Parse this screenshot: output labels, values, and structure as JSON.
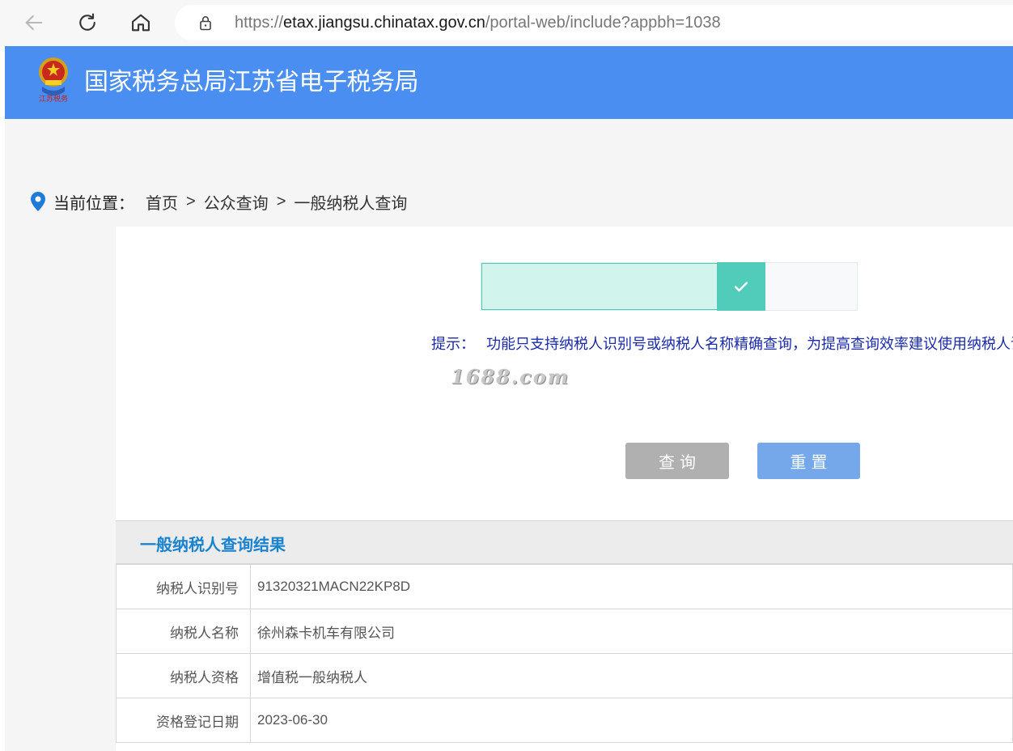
{
  "browser": {
    "url_scheme": "https://",
    "url_host": "etax.jiangsu.chinatax.gov.cn",
    "url_path": "/portal-web/include?appbh=1038"
  },
  "header": {
    "title": "国家税务总局江苏省电子税务局",
    "emblem_caption": "江苏税务"
  },
  "breadcrumb": {
    "label": "当前位置：",
    "items": [
      "首页",
      "公众查询",
      "一般纳税人查询"
    ],
    "separator": ">"
  },
  "slider": {
    "progress_percent": 72
  },
  "hint": {
    "label": "提示：",
    "text": "功能只支持纳税人识别号或纳税人名称精确查询，为提高查询效率建议使用纳税人识别号查询"
  },
  "watermark": "1688.com",
  "buttons": {
    "query": "查询",
    "reset": "重置"
  },
  "result": {
    "title": "一般纳税人查询结果",
    "rows": [
      {
        "field": "纳税人识别号",
        "value": "91320321MACN22KP8D"
      },
      {
        "field": "纳税人名称",
        "value": "徐州森卡机车有限公司"
      },
      {
        "field": "纳税人资格",
        "value": "增值税一般纳税人"
      },
      {
        "field": "资格登记日期",
        "value": "2023-06-30"
      }
    ]
  },
  "colors": {
    "header_blue": "#4a8ef2",
    "result_title": "#1a83cf",
    "hint_text": "#1c2aa8",
    "slider_handle": "#52ccba"
  }
}
